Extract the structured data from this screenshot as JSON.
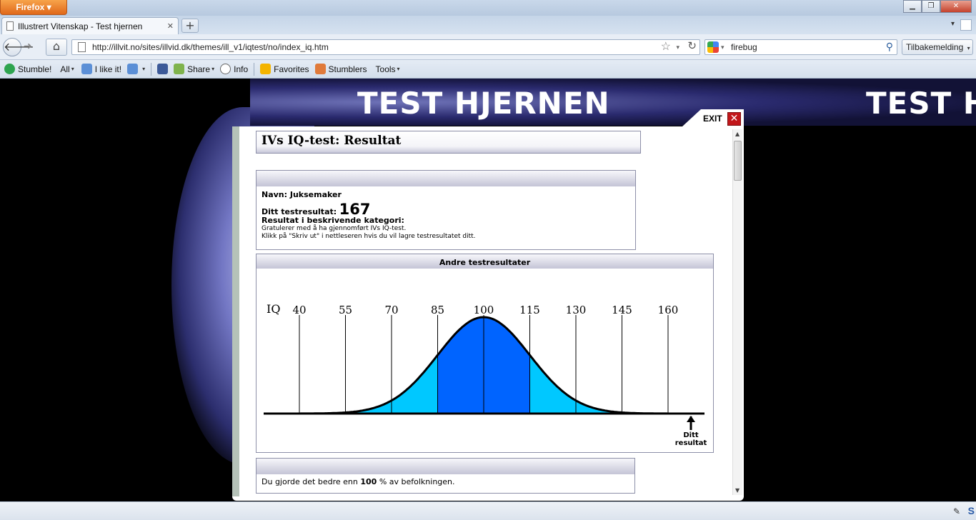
{
  "browser": {
    "app_button": "Firefox",
    "tab_title": "Illustrert Vitenskap - Test hjernen",
    "url": "http://illvit.no/sites/illvid.dk/themes/ill_v1/iqtest/no/index_iq.htm",
    "search_query": "firebug",
    "feedback_button": "Tilbakemelding"
  },
  "toolbar": {
    "stumble": "Stumble!",
    "all": "All",
    "like": "I like it!",
    "share": "Share",
    "info": "Info",
    "favorites": "Favorites",
    "stumblers": "Stumblers",
    "tools": "Tools"
  },
  "page": {
    "banner_title": "TEST HJERNEN",
    "exit_label": "EXIT",
    "title": "IVs IQ-test: Resultat",
    "name_label": "Navn: Juksemaker",
    "score_label": "Ditt testresultat:",
    "score_value": "167",
    "category_label": "Resultat i beskrivende kategori:",
    "congrats": "Gratulerer med å ha gjennomført IVs IQ-test.",
    "print_hint": "Klikk på \"Skriv ut\" i nettleseren hvis du vil lagre testresultatet ditt.",
    "chart_header": "Andre testresultater",
    "percent_prefix": "Du gjorde det bedre enn",
    "percent_value": "100",
    "percent_suffix": "% av befolkningen."
  },
  "chart_data": {
    "type": "area",
    "title": "Andre testresultater",
    "ylabel": "IQ",
    "x_ticks": [
      40,
      55,
      70,
      85,
      100,
      115,
      130,
      145,
      160
    ],
    "distribution": "normal",
    "mean": 100,
    "sd": 15,
    "bands": [
      {
        "from": 55,
        "to": 70,
        "color": "#00c8ff"
      },
      {
        "from": 70,
        "to": 85,
        "color": "#00c8ff"
      },
      {
        "from": 85,
        "to": 100,
        "color": "#0064ff"
      },
      {
        "from": 100,
        "to": 115,
        "color": "#0064ff"
      },
      {
        "from": 115,
        "to": 130,
        "color": "#00c8ff"
      },
      {
        "from": 130,
        "to": 145,
        "color": "#00c8ff"
      }
    ],
    "marker_label_line1": "Ditt",
    "marker_label_line2": "resultat",
    "marker_value": 167
  }
}
